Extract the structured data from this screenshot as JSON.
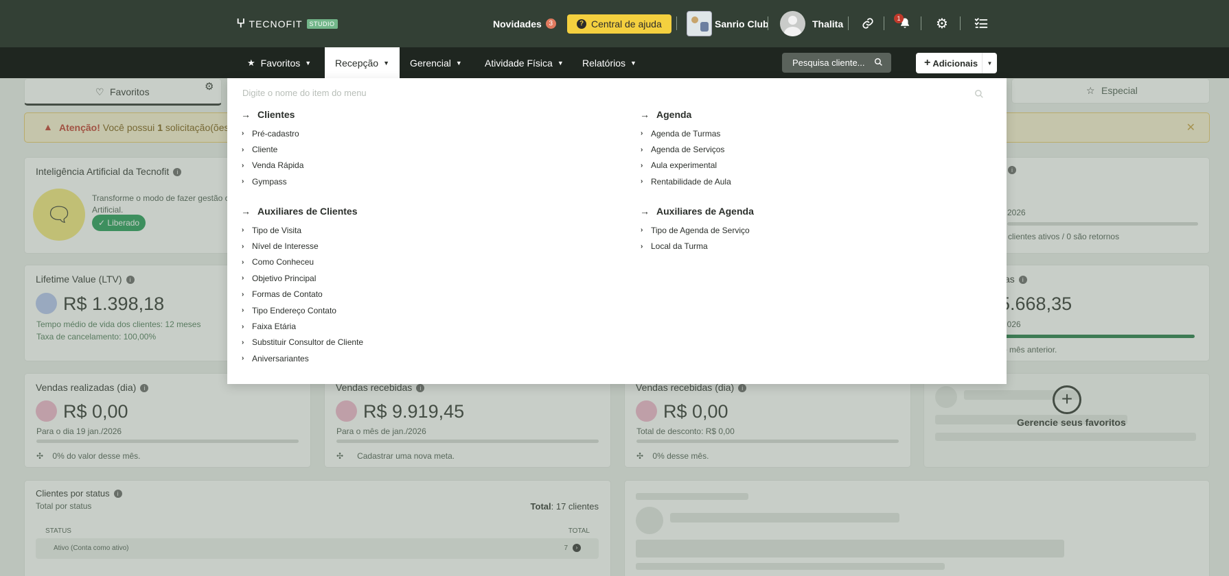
{
  "header": {
    "logo_text": "TECNOFIT",
    "logo_badge": "STUDIO",
    "novidades_label": "Novidades",
    "novidades_count": "3",
    "help_label": "Central de ajuda",
    "club_name": "Sanrio Club",
    "user_name": "Thalita",
    "notif_count": "1",
    "icons": [
      "link-icon",
      "bell-icon",
      "gears-icon",
      "checklist-icon"
    ]
  },
  "nav": {
    "items": [
      {
        "label": "Favoritos"
      },
      {
        "label": "Recepção"
      },
      {
        "label": "Gerencial"
      },
      {
        "label": "Atividade Física"
      },
      {
        "label": "Relatórios"
      }
    ],
    "search_placeholder": "Pesquisa cliente...",
    "add_label": "Adicionais"
  },
  "dropdown": {
    "search_placeholder": "Digite o nome do item do menu",
    "groups": [
      {
        "title": "Clientes",
        "items": [
          "Pré-cadastro",
          "Cliente",
          "Venda Rápida",
          "Gympass"
        ]
      },
      {
        "title": "Auxiliares de Clientes",
        "items": [
          "Tipo de Visita",
          "Nível de Interesse",
          "Como Conheceu",
          "Objetivo Principal",
          "Formas de Contato",
          "Tipo Endereço Contato",
          "Faixa Etária",
          "Substituir Consultor de Cliente",
          "Aniversariantes"
        ]
      },
      {
        "title": "Agenda",
        "items": [
          "Agenda de Turmas",
          "Agenda de Serviços",
          "Aula experimental",
          "Rentabilidade de Aula"
        ]
      },
      {
        "title": "Auxiliares de Agenda",
        "items": [
          "Tipo de Agenda de Serviço",
          "Local da Turma"
        ]
      }
    ]
  },
  "dashboard": {
    "tab_favoritos": "Favoritos",
    "tab_especial": "Especial",
    "alert_strong": "Atenção!",
    "alert_text": "Você possui",
    "alert_count": "1",
    "alert_tail": "solicitação(ões",
    "ai_title": "Inteligência Artificial da Tecnofit",
    "ai_text": "Transforme o modo de fazer gestão c",
    "ai_text2": "Artificial.",
    "ai_badge": "✓ Liberado",
    "ai_right_date": "2026",
    "ai_right_text": "clientes ativos / 0 são retornos",
    "ltv_title": "Lifetime Value (LTV)",
    "ltv_value": "R$ 1.398,18",
    "ltv_line1": "Tempo médio de vida dos clientes: 12 meses",
    "ltv_line2": "Taxa de cancelamento: 100,00%",
    "right_title_tail": "as",
    "right_value": "5.668,35",
    "right_date": "2026",
    "right_foot": "o mês anterior.",
    "right_progress": 1.0,
    "vr_title": "Vendas realizadas (dia)",
    "vr_value": "R$ 0,00",
    "vr_sub": "Para o dia 19 jan./2026",
    "vr_foot": "0% do valor desse mês.",
    "vrec_title": "Vendas recebidas",
    "vrec_value": "R$ 9.919,45",
    "vrec_sub": "Para o mês de jan./2026",
    "vrec_foot": "Cadastrar uma nova meta.",
    "vrd_title": "Vendas recebidas (dia)",
    "vrd_value": "R$ 0,00",
    "vrd_sub": "Total de desconto: R$ 0,00",
    "vrd_foot": "0% desse mês.",
    "fav_label": "Gerencie seus favoritos",
    "cs_title": "Clientes por status",
    "cs_sub": "Total por status",
    "cs_total_label": "Total",
    "cs_total_value": ": 17 clientes",
    "cs_col_status": "STATUS",
    "cs_col_total": "TOTAL",
    "cs_row_label": "Ativo (Conta como ativo)",
    "cs_row_value": "7"
  }
}
